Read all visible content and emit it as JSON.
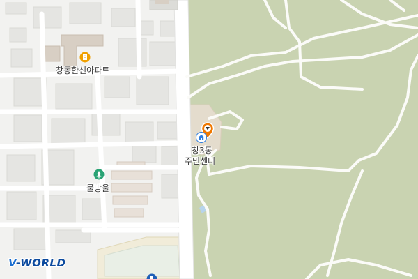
{
  "map": {
    "colors": {
      "park": "#c9d3b1",
      "urban": "#f2f2f0",
      "road": "#ffffff",
      "building": "#e5e5e2",
      "trail": "#fbfbf8",
      "poi_orange": "#f0a000",
      "poi_green": "#2aa374",
      "poi_blue": "#2e7de0",
      "marker_orange": "#f07800"
    },
    "labels": {
      "apartment": "창동한신아파트",
      "center_line1": "창3동",
      "center_line2": "주민센터",
      "park": "물방울"
    },
    "icons": {
      "apartment": "apartment-icon",
      "center": "home-icon",
      "marker": "location-pin-icon",
      "park": "park-icon",
      "bottom": "blue-poi-icon"
    }
  },
  "brand": {
    "v": "V",
    "rest": "-WORLD"
  }
}
